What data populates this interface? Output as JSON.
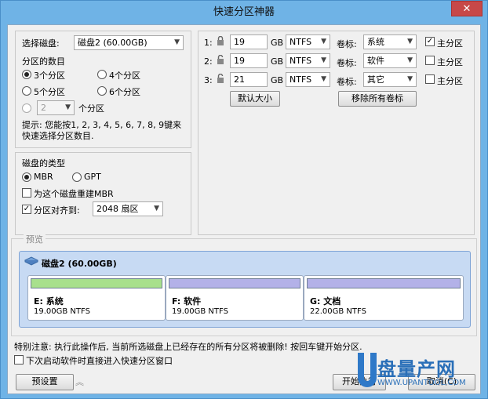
{
  "window": {
    "title": "快速分区神器",
    "close_symbol": "✕"
  },
  "disk": {
    "label": "选择磁盘:",
    "selected": "磁盘2 (60.00GB)",
    "count_label": "分区的数目",
    "count_options": [
      "3个分区",
      "4个分区",
      "5个分区",
      "6个分区"
    ],
    "custom_value": "2",
    "custom_suffix": "个分区",
    "hint": "提示: 您能按1, 2, 3, 4, 5, 6, 7, 8, 9键来快速选择分区数目."
  },
  "disk_type": {
    "label": "磁盘的类型",
    "options": [
      "MBR",
      "GPT"
    ],
    "rebuild_mbr": "为这个磁盘重建MBR",
    "align_label": "分区对齐到:",
    "align_value": "2048 扇区"
  },
  "partitions": [
    {
      "num": "1:",
      "size": "19",
      "unit": "GB",
      "fs": "NTFS",
      "vol_label": "卷标:",
      "vol": "系统",
      "primary": "主分区",
      "primary_checked": true
    },
    {
      "num": "2:",
      "size": "19",
      "unit": "GB",
      "fs": "NTFS",
      "vol_label": "卷标:",
      "vol": "软件",
      "primary": "主分区",
      "primary_checked": false
    },
    {
      "num": "3:",
      "size": "21",
      "unit": "GB",
      "fs": "NTFS",
      "vol_label": "卷标:",
      "vol": "其它",
      "primary": "主分区",
      "primary_checked": false
    }
  ],
  "buttons": {
    "default_size": "默认大小",
    "remove_labels": "移除所有卷标",
    "preset": "预设置",
    "start": "开始执行",
    "cancel": "取消(C)"
  },
  "preview": {
    "legend": "预览",
    "disk_name": "磁盘2 (60.00GB)",
    "parts": [
      {
        "name": "E: 系统",
        "info": "19.00GB NTFS",
        "color": "#a8e08c"
      },
      {
        "name": "F: 软件",
        "info": "19.00GB NTFS",
        "color": "#b3b1e8"
      },
      {
        "name": "G: 文档",
        "info": "22.00GB NTFS",
        "color": "#b3b1e8"
      }
    ]
  },
  "notice": "特别注意: 执行此操作后, 当前所选磁盘上已经存在的所有分区将被删除! 按回车键开始分区.",
  "next_time": "下次启动软件时直接进入快速分区窗口",
  "watermark": {
    "brand": "盘量产网",
    "url": "WWW.UPANTOOL.COM"
  }
}
